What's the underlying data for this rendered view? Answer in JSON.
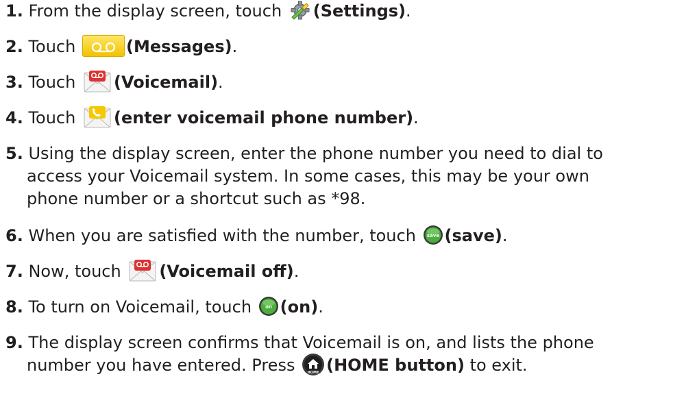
{
  "steps": [
    {
      "num": "1.",
      "before": " From the display screen, touch ",
      "icon": "settings-wrench-icon",
      "bold": "(Settings)",
      "after": "."
    },
    {
      "num": "2.",
      "before": " Touch ",
      "icon": "messages-voicemail-tape-icon",
      "bold": "(Messages)",
      "after": "."
    },
    {
      "num": "3.",
      "before": " Touch ",
      "icon": "voicemail-envelope-icon",
      "bold": "(Voicemail)",
      "after": "."
    },
    {
      "num": "4.",
      "before": " Touch ",
      "icon": "voicemail-phone-envelope-icon",
      "bold": "(enter voicemail phone number)",
      "after": "."
    },
    {
      "num": "5.",
      "line1": " Using the display screen, enter the phone number you need to dial to",
      "line2": "access your Voicemail system. In some cases, this may be your own",
      "line3": "phone number or a shortcut such as *98."
    },
    {
      "num": "6.",
      "before": " When you are satisfied with the number, touch ",
      "icon": "save-button-icon",
      "icon_text": "save",
      "bold": "(save)",
      "after": "."
    },
    {
      "num": "7.",
      "before": " Now, touch ",
      "icon": "voicemail-envelope-icon",
      "bold": "(Voicemail off)",
      "after": "."
    },
    {
      "num": "8.",
      "before": " To turn on Voicemail, touch ",
      "icon": "on-button-icon",
      "icon_text": "on",
      "bold": "(on)",
      "after": "."
    },
    {
      "num": "9.",
      "line1": " The display screen confirms that Voicemail is on, and lists the phone",
      "line2_before": "number you have entered. Press ",
      "icon": "home-button-icon",
      "icon_text": "HOME",
      "bold": "(HOME button)",
      "after": " to exit."
    }
  ],
  "colors": {
    "text": "#231f20",
    "messages_icon": "#f6c800",
    "voicemail_red": "#e0312e",
    "button_green": "#4cae3c",
    "home_dark": "#3a3a3a"
  }
}
